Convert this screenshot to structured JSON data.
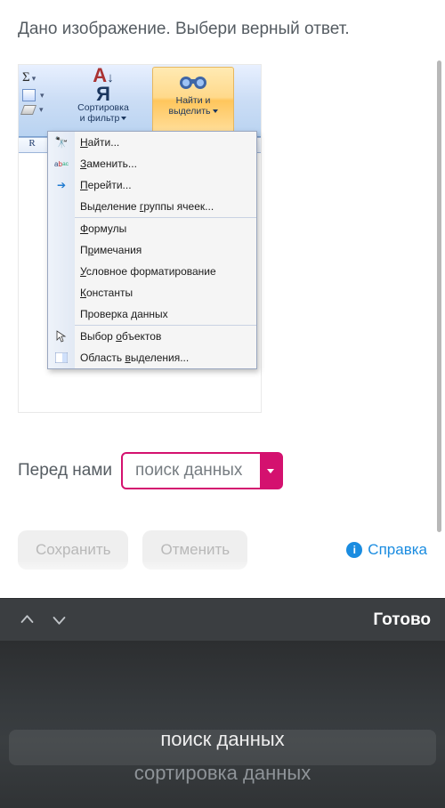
{
  "question": "Дано изображение. Выбери верный ответ.",
  "ribbon": {
    "sort_label_l1": "Сортировка",
    "sort_label_l2": "и фильтр",
    "find_label_l1": "Найти и",
    "find_label_l2": "выделить"
  },
  "dropdown_items": [
    {
      "icon": "binoculars",
      "label_pre": "",
      "u": "Н",
      "label_post": "айти..."
    },
    {
      "icon": "replace",
      "label_pre": "",
      "u": "З",
      "label_post": "аменить..."
    },
    {
      "icon": "goto",
      "label_pre": "",
      "u": "П",
      "label_post": "ерейти..."
    },
    {
      "icon": "",
      "label_pre": "Выделение ",
      "u": "г",
      "label_post": "руппы ячеек..."
    }
  ],
  "dropdown_group2": [
    {
      "label_pre": "",
      "u": "Ф",
      "label_post": "ормулы"
    },
    {
      "label_pre": "П",
      "u": "р",
      "label_post": "имечания"
    },
    {
      "label_pre": "",
      "u": "У",
      "label_post": "словное форматирование"
    },
    {
      "label_pre": "",
      "u": "К",
      "label_post": "онстанты"
    },
    {
      "label_pre": "Проверка ",
      "u": "д",
      "label_post": "анных"
    }
  ],
  "dropdown_group3": [
    {
      "icon": "pointer",
      "label_pre": "Выбор ",
      "u": "о",
      "label_post": "бъектов"
    },
    {
      "icon": "pane",
      "label_pre": "Область ",
      "u": "в",
      "label_post": "ыделения..."
    }
  ],
  "grid_header": "R",
  "answer": {
    "prefix": "Перед нами",
    "selected": "поиск данных"
  },
  "buttons": {
    "save": "Сохранить",
    "cancel": "Отменить",
    "help": "Справка"
  },
  "keyboard": {
    "done": "Готово"
  },
  "picker": {
    "selected": "поиск данных",
    "next": "сортировка данных"
  }
}
